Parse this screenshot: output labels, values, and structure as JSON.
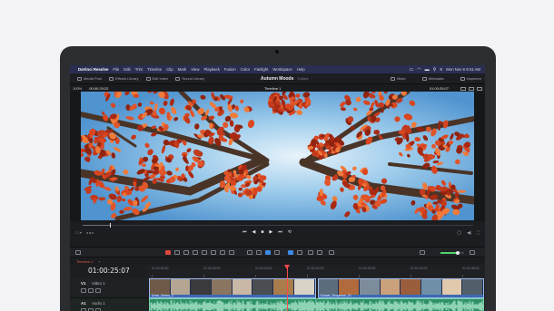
{
  "colors": {
    "page_bg": "#f3f3f5",
    "bezel": "#2b2d31",
    "menubar": "#2a2e50",
    "video_track": "#3d69b3",
    "audio_track": "#2e8f67",
    "playhead": "#ff4a4a",
    "accent_blue": "#3c8be8",
    "accent_red": "#e0473d"
  },
  "menubar": {
    "app": "DaVinci Resolve",
    "items": [
      "File",
      "Edit",
      "Trim",
      "Timeline",
      "Clip",
      "Mark",
      "View",
      "Playback",
      "Fusion",
      "Color",
      "Fairlight",
      "Workspace",
      "Help"
    ],
    "status_icons": [
      "airplay-icon",
      "wifi-icon",
      "battery-icon",
      "search-icon",
      "control-center-icon"
    ],
    "clock": "Mon Nov 6 9:41 AM"
  },
  "toolbar": {
    "tools": [
      {
        "icon": "media-pool-icon",
        "label": "Media Pool"
      },
      {
        "icon": "effects-library-icon",
        "label": "Effects Library"
      },
      {
        "icon": "edit-index-icon",
        "label": "Edit Index"
      },
      {
        "icon": "sound-library-icon",
        "label": "Sound Library"
      }
    ],
    "project_name": "Autumn Moods",
    "project_status": "Edited",
    "right_tools": [
      {
        "icon": "mixer-icon",
        "label": "Mixer"
      },
      {
        "icon": "metadata-icon",
        "label": "Metadata"
      },
      {
        "icon": "inspector-icon",
        "label": "Inspector"
      }
    ]
  },
  "viewer": {
    "zoom": "100%",
    "source_timecode": "00:00:29:22",
    "timeline_name": "Timeline 1",
    "record_timecode": "01:00:25:07",
    "progress_fraction": 0.07
  },
  "transport": {
    "controls": [
      "⏮",
      "◀",
      "■",
      "▶",
      "⏭",
      "⟲"
    ],
    "left_icons": [
      "☐ ▾",
      "◂ ● ▸"
    ],
    "right_icons": [
      "◯",
      "◀|",
      "⛶"
    ]
  },
  "edit_tools": {
    "audio_level_fraction": 0.72
  },
  "timeline": {
    "tab_label": "Timeline 1",
    "add_tab": "+",
    "timecode": "01:00:25:07",
    "ruler_labels": [
      "01:00:00:00",
      "01:00:08:00",
      "01:00:16:00",
      "01:00:24:00",
      "01:00:32:00",
      "01:00:40:00",
      "01:00:48:00"
    ],
    "tracks": [
      {
        "id": "V1",
        "name": "Video 1",
        "type": "video",
        "clips": [
          {
            "label": "Drive_Series_1",
            "start": 0.0,
            "end": 0.5
          },
          {
            "label": "Sunset_Sequence_01",
            "start": 0.5,
            "end": 1.0
          }
        ]
      },
      {
        "id": "A1",
        "name": "Audio 1",
        "type": "audio",
        "clips": [
          {
            "label": "Main Theme",
            "start": 0.0,
            "end": 1.0
          }
        ]
      }
    ]
  }
}
